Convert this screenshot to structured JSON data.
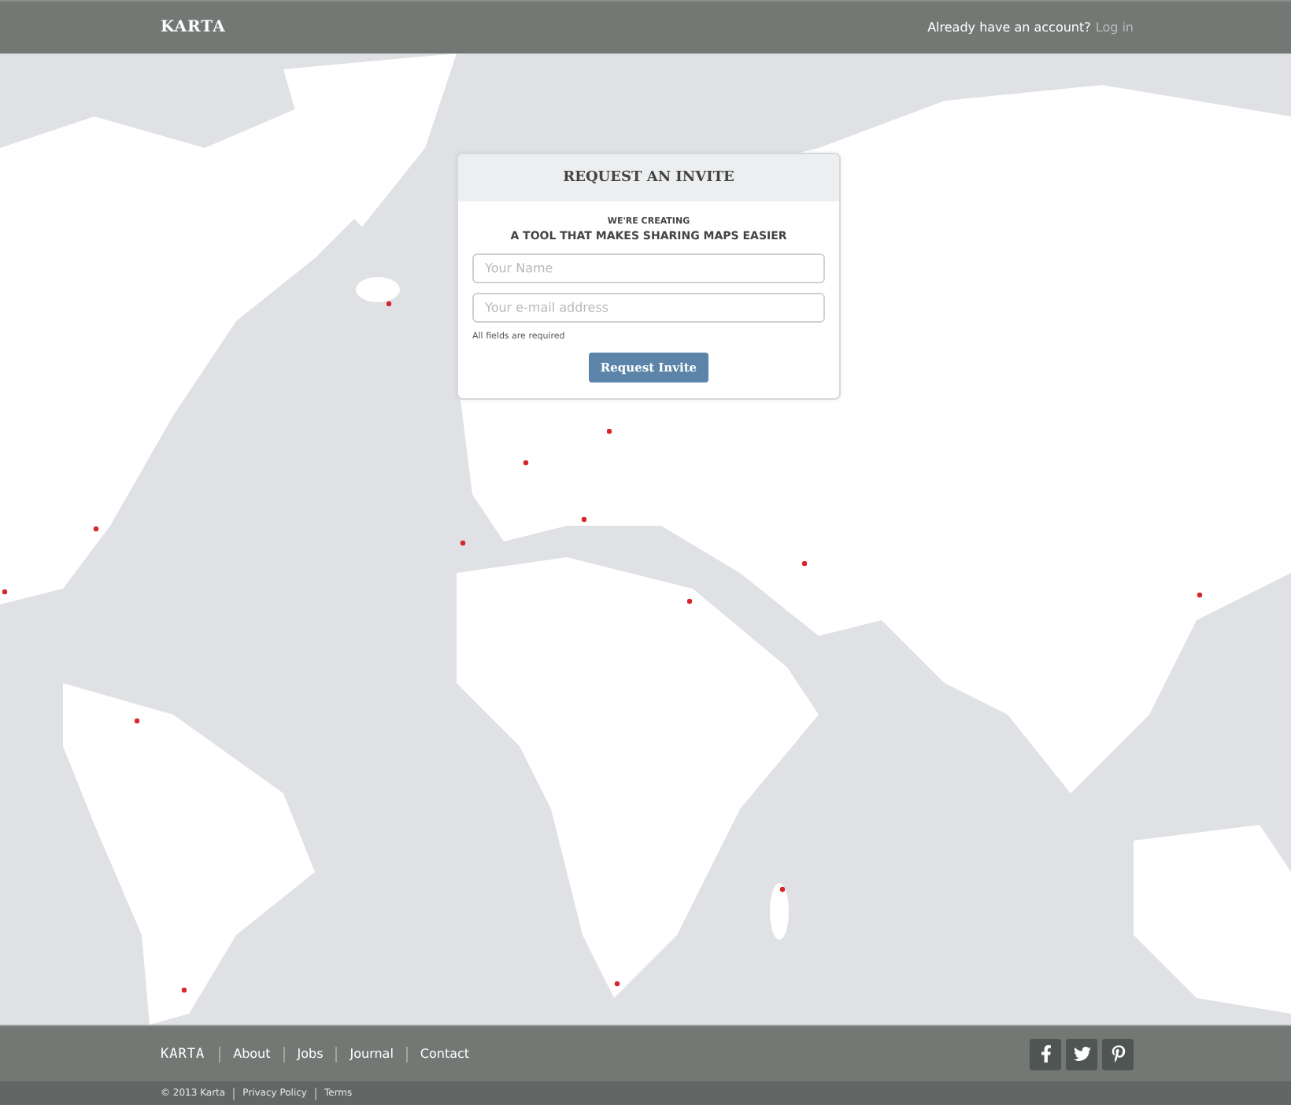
{
  "header": {
    "logo": "KARTA",
    "account_prompt": "Already have an account?",
    "login_link": "Log in"
  },
  "invite_card": {
    "title": "REQUEST AN INVITE",
    "tagline_small": "WE'RE CREATING",
    "tagline": "A TOOL THAT MAKES SHARING MAPS EASIER",
    "fields": [
      {
        "placeholder": "Your Name"
      },
      {
        "placeholder": "Your e-mail address"
      }
    ],
    "note": "All fields are required",
    "button": "Request Invite"
  },
  "footer": {
    "logo": "KARTA",
    "links": [
      "About",
      "Jobs",
      "Journal",
      "Contact"
    ],
    "social": [
      {
        "kind": "facebook"
      },
      {
        "kind": "twitter"
      },
      {
        "kind": "pinterest"
      }
    ]
  },
  "bottom_bar": {
    "items": [
      "© 2013 Karta",
      "Privacy Policy",
      "Terms"
    ]
  }
}
